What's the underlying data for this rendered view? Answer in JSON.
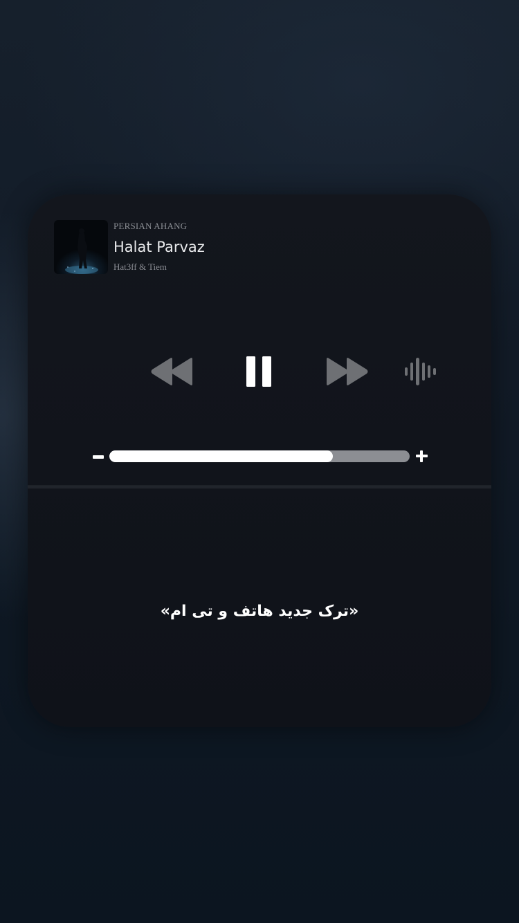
{
  "player": {
    "source_label": "PERSIAN AHANG",
    "song_title": "Halat Parvaz",
    "artist": "Hat3ff & Tiem",
    "artwork_icon": "album-artwork",
    "state": "playing",
    "controls": {
      "rewind_icon": "rewind-icon",
      "pause_icon": "pause-icon",
      "forward_icon": "fast-forward-icon",
      "audio_output_icon": "sound-wave-icon"
    },
    "volume": {
      "level_fraction": 0.745,
      "minus_icon": "minus-icon",
      "plus_icon": "plus-icon"
    }
  },
  "caption": "«ترک جدید هاتف و تی ام»",
  "colors": {
    "card_background": "#12151c",
    "primary_icon": "#ffffff",
    "secondary_icon": "#6e7074",
    "volume_track": "#8c8e93",
    "volume_fill": "#ffffff",
    "muted_text": "#8a8d93"
  }
}
